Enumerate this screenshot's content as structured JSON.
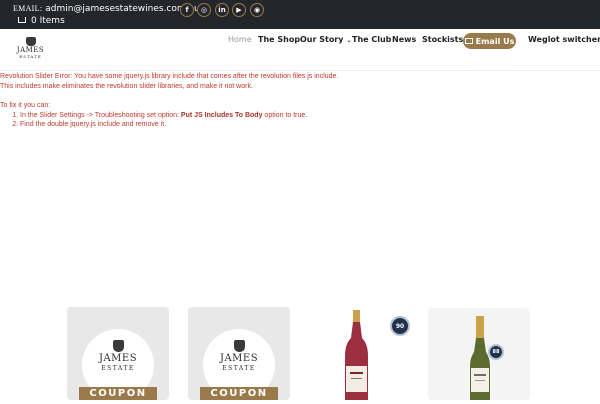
{
  "topbar": {
    "email_label": "EMAIL:",
    "email": "admin@jamesestatewines.com.au",
    "cart_text": "0 Items",
    "social_icons": [
      "facebook-icon",
      "instagram-icon",
      "linkedin-icon",
      "youtube-icon",
      "rss-icon"
    ],
    "social_glyphs": [
      "f",
      "◎",
      "in",
      "▶",
      "◉"
    ]
  },
  "header": {
    "logo_name": "JAMES",
    "logo_sub": "ESTATE",
    "nav": [
      {
        "label": "Home"
      },
      {
        "label": "The Shop"
      },
      {
        "label": "Our Story"
      },
      {
        "label": "The Club"
      },
      {
        "label": "News"
      },
      {
        "label": "Stockists"
      }
    ],
    "email_button": "Email Us",
    "weglot": "Weglot switcher"
  },
  "error": {
    "line1": "Revolution Slider Error: You have some jquery.js library include that comes after the revolution files js include.",
    "line2": "This includes make eliminates the revolution slider libraries, and make it not work.",
    "fix_heading": "To fix it you can:",
    "step1_pre": "In the Slider Settings -> Troubleshooting set option:",
    "step1_bold": "Put JS Includes To Body",
    "step1_post": "option to true.",
    "step2": "Find the double jquery.js include and remove it."
  },
  "products": {
    "coupon_label": "COUPON",
    "card_name": "JAMES",
    "card_sub": "ESTATE",
    "badge1": "90",
    "badge2": "88"
  },
  "colors": {
    "topbar_bg": "#23262b",
    "accent_gold": "#9a7a4a",
    "error_red": "#c0392b",
    "card_bg": "#e8e8e8"
  }
}
